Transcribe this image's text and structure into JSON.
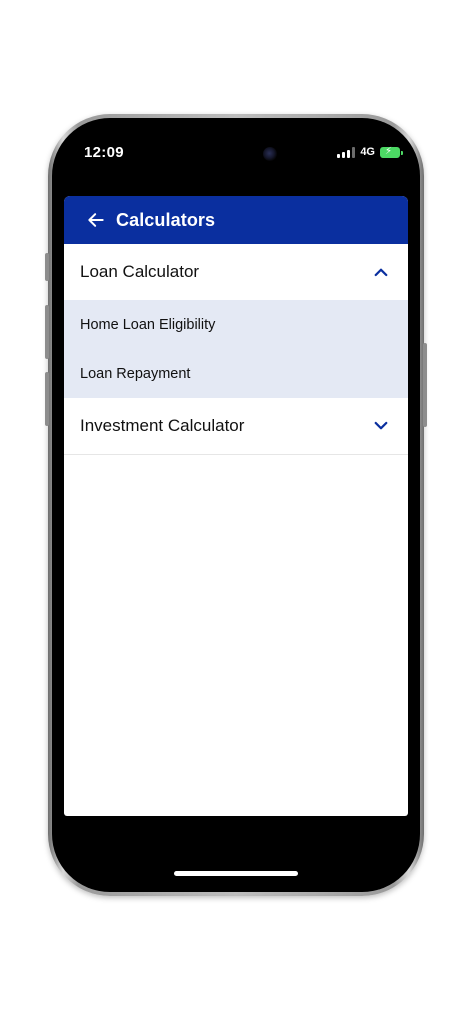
{
  "status_bar": {
    "time": "12:09",
    "network": "4G"
  },
  "header": {
    "title": "Calculators",
    "back_icon": "arrow-left-icon",
    "background_color": "#0a2f9f"
  },
  "sections": [
    {
      "label": "Loan Calculator",
      "expanded": true,
      "chevron_icon": "chevron-up-icon",
      "items": [
        {
          "label": "Home Loan Eligibility"
        },
        {
          "label": "Loan Repayment"
        }
      ]
    },
    {
      "label": "Investment Calculator",
      "expanded": false,
      "chevron_icon": "chevron-down-icon",
      "items": []
    }
  ],
  "colors": {
    "accent": "#0a2f9f",
    "expanded_background": "#e4e9f4"
  }
}
